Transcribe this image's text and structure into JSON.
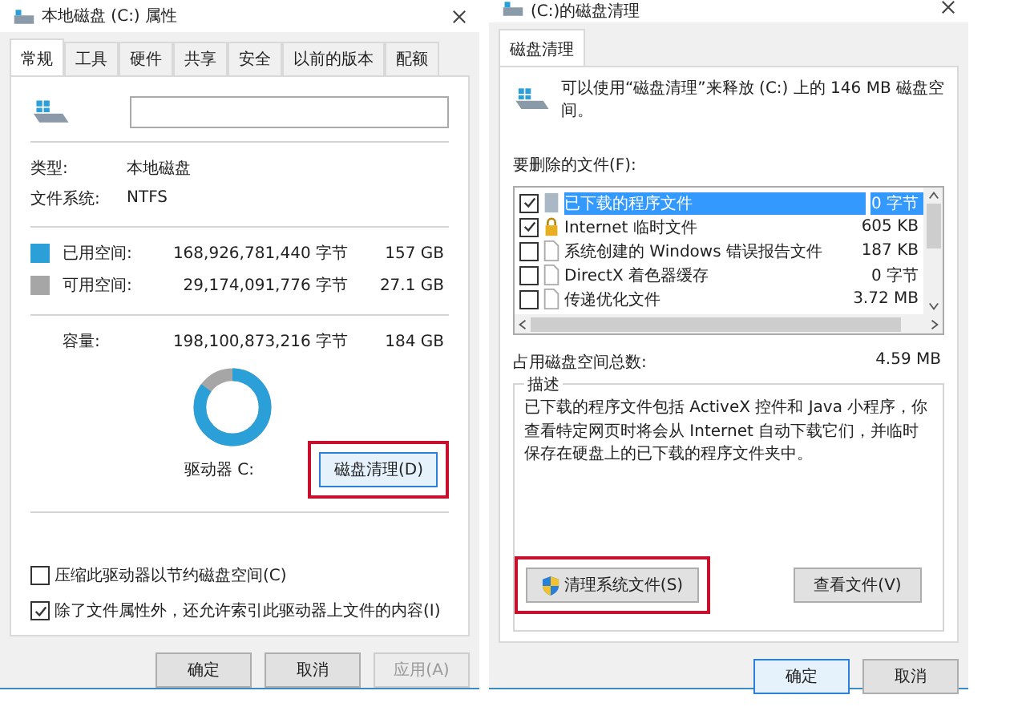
{
  "properties_window": {
    "title": "本地磁盘 (C:) 属性",
    "tabs": [
      {
        "label": "常规",
        "selected": true
      },
      {
        "label": "工具",
        "selected": false
      },
      {
        "label": "硬件",
        "selected": false
      },
      {
        "label": "共享",
        "selected": false
      },
      {
        "label": "安全",
        "selected": false
      },
      {
        "label": "以前的版本",
        "selected": false
      },
      {
        "label": "配额",
        "selected": false
      }
    ],
    "info": [
      {
        "label": "类型:",
        "value": "本地磁盘"
      },
      {
        "label": "文件系统:",
        "value": "NTFS"
      }
    ],
    "space": [
      {
        "label": "已用空间:",
        "bytes": "168,926,781,440 字节",
        "size": "157 GB",
        "color": "#2a9fd8"
      },
      {
        "label": "可用空间:",
        "bytes": "29,174,091,776 字节",
        "size": "27.1 GB",
        "color": "#a6a6a6"
      }
    ],
    "capacity": {
      "label": "容量:",
      "bytes": "198,100,873,216 字节",
      "size": "184 GB"
    },
    "usage": {
      "level": 0.85
    },
    "drive_label": "驱动器 C:",
    "cleanup_button": {
      "label": "磁盘清理(D)",
      "highlighted": true
    },
    "options": [
      {
        "label": "压缩此驱动器以节约磁盘空间(C)",
        "checked": false
      },
      {
        "label": "除了文件属性外，还允许索引此驱动器上文件的内容(I)",
        "checked": true
      }
    ],
    "buttons": [
      {
        "label": "确定",
        "disabled": false
      },
      {
        "label": "取消",
        "disabled": false
      },
      {
        "label": "应用(A)",
        "disabled": true
      }
    ]
  },
  "cleanup_window": {
    "title": "(C:)的磁盘清理",
    "tabs": [
      {
        "label": "磁盘清理",
        "selected": true
      }
    ],
    "message": "可以使用“磁盘清理”来释放 (C:) 上的 146 MB 磁盘空间。",
    "files_label": "要删除的文件(F):",
    "files": [
      {
        "kind": "program",
        "name": "已下载的程序文件",
        "size": "0 字节",
        "checked": true,
        "selected": true
      },
      {
        "kind": "locked",
        "name": "Internet 临时文件",
        "size": "605 KB",
        "checked": true,
        "selected": false
      },
      {
        "kind": "file",
        "name": "系统创建的 Windows 错误报告文件",
        "size": "187 KB",
        "checked": false,
        "selected": false
      },
      {
        "kind": "file",
        "name": "DirectX 着色器缓存",
        "size": "0 字节",
        "checked": false,
        "selected": false
      },
      {
        "kind": "file",
        "name": "传递优化文件",
        "size": "3.72 MB",
        "checked": false,
        "selected": false
      }
    ],
    "total_label": "占用磁盘空间总数:",
    "total": "4.59 MB",
    "description_title": "描述",
    "description": "已下载的程序文件包括 ActiveX 控件和 Java 小程序，你查看特定网页时将会从 Internet 自动下载它们，并临时保存在硬盘上的已下载的程序文件夹中。",
    "system_button": {
      "label": "清理系统文件(S)",
      "highlighted": true
    },
    "view_button": {
      "label": "查看文件(V)",
      "highlighted": false
    },
    "buttons": [
      {
        "label": "确定",
        "default": true
      },
      {
        "label": "取消",
        "default": false
      }
    ]
  }
}
